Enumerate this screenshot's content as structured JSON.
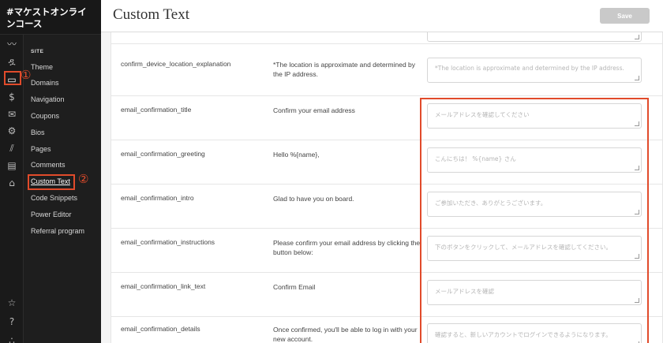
{
  "app": {
    "brand": "#マケストオンラインコース"
  },
  "sidebar": {
    "section_label": "SITE",
    "items": [
      {
        "label": "Theme"
      },
      {
        "label": "Domains"
      },
      {
        "label": "Navigation"
      },
      {
        "label": "Coupons"
      },
      {
        "label": "Bios"
      },
      {
        "label": "Pages"
      },
      {
        "label": "Comments"
      },
      {
        "label": "Custom Text"
      },
      {
        "label": "Code Snippets"
      },
      {
        "label": "Power Editor"
      },
      {
        "label": "Referral program"
      }
    ],
    "rail_icons": [
      "analytics-icon",
      "people-icon",
      "site-icon",
      "dollar-icon",
      "mail-icon",
      "settings-icon",
      "library-icon",
      "calendar-icon",
      "apps-icon",
      "star-icon",
      "help-icon",
      "team-icon"
    ]
  },
  "annotations": {
    "one": "①",
    "two": "②",
    "color": "#e14b2b"
  },
  "header": {
    "title": "Custom Text",
    "save_label": "Save"
  },
  "rows": [
    {
      "key": "confirm_device_location_explanation",
      "value": "*The location is approximate and determined by the IP address.",
      "placeholder": "*The location is approximate and determined by the IP address."
    },
    {
      "key": "email_confirmation_title",
      "value": "Confirm your email address",
      "placeholder": "メールアドレスを確認してください"
    },
    {
      "key": "email_confirmation_greeting",
      "value": "Hello %{name},",
      "placeholder": "こんにちは！ %{name} さん"
    },
    {
      "key": "email_confirmation_intro",
      "value": "Glad to have you on board.",
      "placeholder": "ご参加いただき、ありがとうございます。"
    },
    {
      "key": "email_confirmation_instructions",
      "value": "Please confirm your email address by clicking the button below:",
      "placeholder": "下のボタンをクリックして、メールアドレスを確認してください。"
    },
    {
      "key": "email_confirmation_link_text",
      "value": "Confirm Email",
      "placeholder": "メールアドレスを確認"
    },
    {
      "key": "email_confirmation_details",
      "value": "Once confirmed, you'll be able to log in with your new account.",
      "placeholder": "確認すると、新しいアカウントでログインできるようになります。"
    }
  ]
}
